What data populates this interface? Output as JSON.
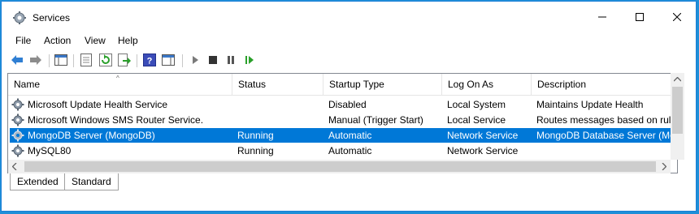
{
  "window": {
    "title": "Services"
  },
  "menu": [
    "File",
    "Action",
    "View",
    "Help"
  ],
  "columns": [
    "Name",
    "Status",
    "Startup Type",
    "Log On As",
    "Description"
  ],
  "rows": [
    {
      "name": "Microsoft Update Health Service",
      "status": "",
      "startup": "Disabled",
      "logon": "Local System",
      "desc": "Maintains Update Health"
    },
    {
      "name": "Microsoft Windows SMS Router Service.",
      "status": "",
      "startup": "Manual (Trigger Start)",
      "logon": "Local Service",
      "desc": "Routes messages based on rule..."
    },
    {
      "name": "MongoDB Server (MongoDB)",
      "status": "Running",
      "startup": "Automatic",
      "logon": "Network Service",
      "desc": "MongoDB Database Server (Mo...",
      "selected": true
    },
    {
      "name": "MySQL80",
      "status": "Running",
      "startup": "Automatic",
      "logon": "Network Service",
      "desc": ""
    }
  ],
  "tabs": [
    "Extended",
    "Standard"
  ],
  "colors": {
    "selection": "#0078d7",
    "border": "#1b7fd6"
  }
}
